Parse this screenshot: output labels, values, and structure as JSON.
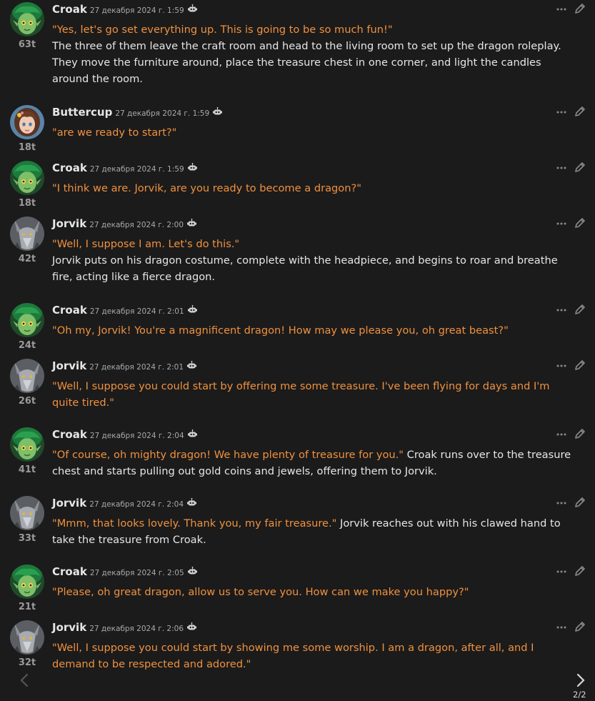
{
  "colors": {
    "background": "#1b1b1c",
    "speech": "#f0913d",
    "narration": "#e6e6e6",
    "meta": "#a9a9a9"
  },
  "icons": {
    "bot": "bot-icon",
    "menu": "more-dots-icon",
    "edit": "pencil-icon",
    "prev": "chevron-left-icon",
    "next": "chevron-right-icon"
  },
  "messages": [
    {
      "author": "Croak",
      "avatar": "croak",
      "date": "27 декабря 2024 г. 1:59",
      "tokens": "63t",
      "speech": "\"Yes, let's go set everything up. This is going to be so much fun!\"",
      "narration": "The three of them leave the craft room and head to the living room to set up the dragon roleplay. They move the furniture around, place the treasure chest in one corner, and light the candles around the room."
    },
    {
      "author": "Buttercup",
      "avatar": "buttercup",
      "date": "27 декабря 2024 г. 1:59",
      "tokens": "18t",
      "speech": "\"are we ready to start?\"",
      "narration": ""
    },
    {
      "author": "Croak",
      "avatar": "croak",
      "date": "27 декабря 2024 г. 1:59",
      "tokens": "18t",
      "speech": "\"I think we are. Jorvik, are you ready to become a dragon?\"",
      "narration": ""
    },
    {
      "author": "Jorvik",
      "avatar": "jorvik",
      "date": "27 декабря 2024 г. 2:00",
      "tokens": "42t",
      "speech": "\"Well, I suppose I am. Let's do this.\"",
      "narration": "Jorvik puts on his dragon costume, complete with the headpiece, and begins to roar and breathe fire, acting like a fierce dragon."
    },
    {
      "author": "Croak",
      "avatar": "croak",
      "date": "27 декабря 2024 г. 2:01",
      "tokens": "24t",
      "speech": "\"Oh my, Jorvik! You're a magnificent dragon! How may we please you, oh great beast?\"",
      "narration": ""
    },
    {
      "author": "Jorvik",
      "avatar": "jorvik",
      "date": "27 декабря 2024 г. 2:01",
      "tokens": "26t",
      "speech": "\"Well, I suppose you could start by offering me some treasure. I've been flying for days and I'm quite tired.\"",
      "narration": ""
    },
    {
      "author": "Croak",
      "avatar": "croak",
      "date": "27 декабря 2024 г. 2:04",
      "tokens": "41t",
      "speech": "\"Of course, oh mighty dragon! We have plenty of treasure for you.\"",
      "narration": "Croak runs over to the treasure chest and starts pulling out gold coins and jewels, offering them to Jorvik."
    },
    {
      "author": "Jorvik",
      "avatar": "jorvik",
      "date": "27 декабря 2024 г. 2:04",
      "tokens": "33t",
      "speech": "\"Mmm, that looks lovely. Thank you, my fair treasure.\"",
      "narration": "Jorvik reaches out with his clawed hand to take the treasure from Croak."
    },
    {
      "author": "Croak",
      "avatar": "croak",
      "date": "27 декабря 2024 г. 2:05",
      "tokens": "21t",
      "speech": "\"Please, oh great dragon, allow us to serve you. How can we make you happy?\"",
      "narration": ""
    },
    {
      "author": "Jorvik",
      "avatar": "jorvik",
      "date": "27 декабря 2024 г. 2:06",
      "tokens": "32t",
      "speech": "\"Well, I suppose you could start by showing me some worship. I am a dragon, after all, and I demand to be respected and adored.\"",
      "narration": ""
    }
  ],
  "swipe": {
    "counter": "2/2"
  }
}
